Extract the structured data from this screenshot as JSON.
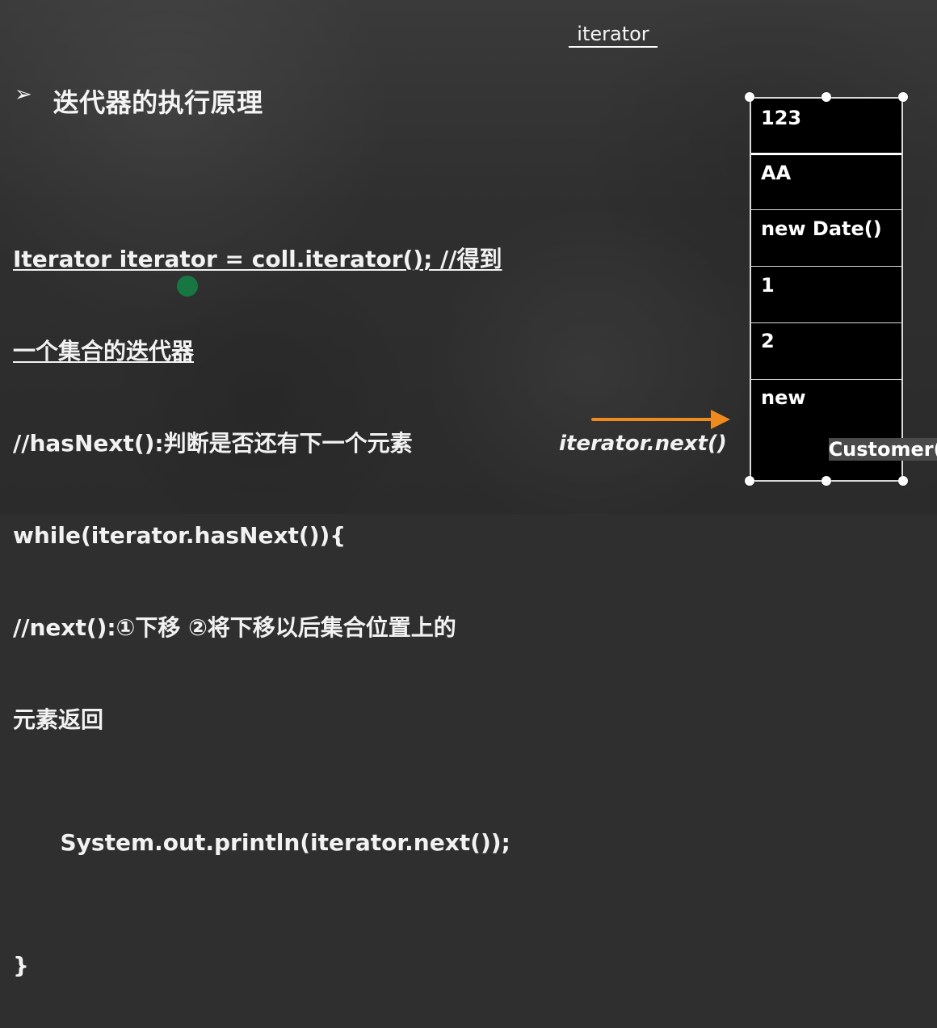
{
  "header": {
    "top_label": "iterator"
  },
  "slide": {
    "heading_bullet": "➢",
    "heading_text": "迭代器的执行原理",
    "code_lines": [
      "Iterator iterator = coll.iterator(); //得到",
      "一个集合的迭代器",
      "//hasNext():判断是否还有下一个元素",
      "while(iterator.hasNext()){",
      "//next():①下移 ②将下移以后集合位置上的",
      "元素返回",
      "System.out.println(iterator.next());",
      "}"
    ],
    "stack_cells": [
      "123",
      "AA",
      "new Date()",
      "1",
      "2",
      "new",
      "Customer()"
    ],
    "pointer_label": "iterator.next()"
  },
  "colors": {
    "background": "#2f2f2f",
    "text": "#f2f2f2",
    "accent": "#ef8a1f",
    "stack_bg": "#000000",
    "stack_border": "#d9d9d9"
  },
  "icons": {
    "bullet": "arrowhead-bullet-icon",
    "arrow": "right-arrow-icon",
    "handle": "selection-handle-icon"
  }
}
